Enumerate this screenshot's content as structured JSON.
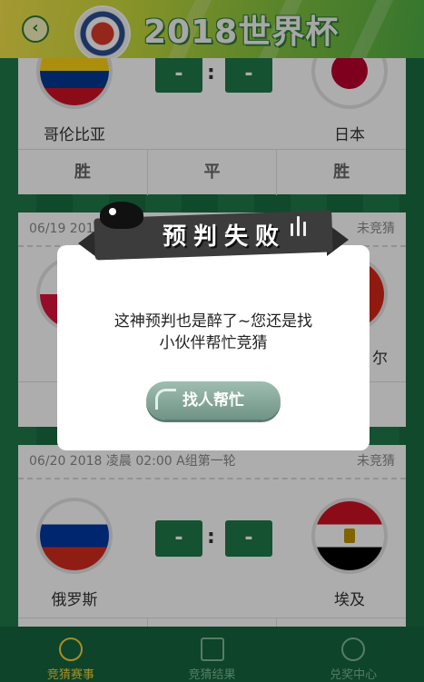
{
  "header": {
    "title": "2018世界杯",
    "back_glyph": "‹"
  },
  "matches": [
    {
      "home": "哥伦比亚",
      "away": "日本",
      "home_score": "-",
      "away_score": "-",
      "bets": [
        "胜",
        "平",
        "胜"
      ]
    },
    {
      "datetime": "06/19 2018",
      "status": "未竞猜",
      "away_partial": "尔"
    },
    {
      "datetime": "06/20 2018 凌晨 02:00 A组第一轮",
      "status": "未竞猜",
      "home": "俄罗斯",
      "away": "埃及",
      "home_score": "-",
      "away_score": "-"
    }
  ],
  "modal": {
    "title": "预判失败",
    "message_line1": "这神预判也是醉了~您还是找",
    "message_line2": "小伙伴帮忙竞猜",
    "button": "找人帮忙"
  },
  "nav": [
    {
      "label": "竞猜赛事",
      "icon": "soccer-ball-icon",
      "active": true
    },
    {
      "label": "竞猜结果",
      "icon": "document-icon",
      "active": false
    },
    {
      "label": "兑奖中心",
      "icon": "soccer-ball-icon",
      "active": false
    }
  ],
  "colors": {
    "primary_green": "#1e7a4a",
    "nav_active": "#f4d23a"
  }
}
